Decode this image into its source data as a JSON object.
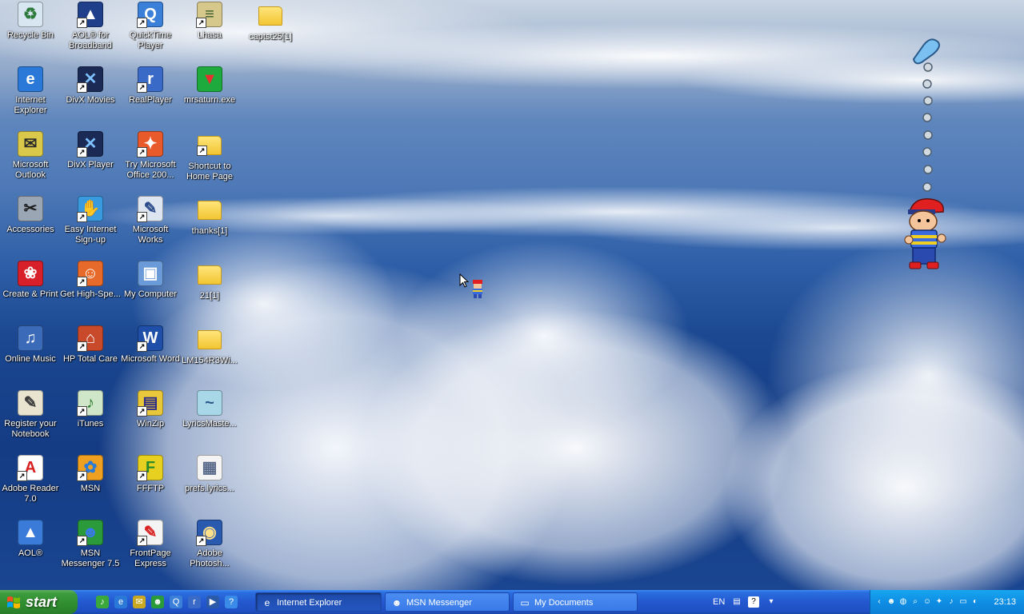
{
  "desktop_icons": [
    {
      "label": "Recycle Bin",
      "icon": "recycle-bin-icon",
      "glyph": "♻",
      "color": "#d8e6f2",
      "fg": "#2e7a3c",
      "shortcut": false
    },
    {
      "label": "AOL® for Broadband",
      "icon": "aol-icon",
      "glyph": "▲",
      "color": "#1f3f8a",
      "fg": "#ffffff",
      "shortcut": true
    },
    {
      "label": "QuickTime Player",
      "icon": "quicktime-icon",
      "glyph": "Q",
      "color": "#3a7fd8",
      "fg": "#ffffff",
      "shortcut": true
    },
    {
      "label": "Lhasa",
      "icon": "lhasa-archive-icon",
      "glyph": "≡",
      "color": "#d6c78a",
      "fg": "#3a5a2a",
      "shortcut": true
    },
    {
      "label": "captst25[1]",
      "icon": "folder-icon",
      "glyph": "",
      "color": "folder",
      "fg": "",
      "shortcut": false
    },
    {
      "label": "Internet Explorer",
      "icon": "internet-explorer-icon",
      "glyph": "e",
      "color": "#2a78d8",
      "fg": "#ffffff",
      "shortcut": false
    },
    {
      "label": "DivX Movies",
      "icon": "divx-movies-icon",
      "glyph": "✕",
      "color": "#1a2a55",
      "fg": "#7fc0ff",
      "shortcut": true
    },
    {
      "label": "RealPlayer",
      "icon": "realplayer-icon",
      "glyph": "r",
      "color": "#3a6ac8",
      "fg": "#ffffff",
      "shortcut": true
    },
    {
      "label": "mrsaturn.exe",
      "icon": "mrsaturn-icon",
      "glyph": "▼",
      "color": "#1eaa3c",
      "fg": "#e83030",
      "shortcut": false
    },
    {
      "label": "Microsoft Outlook",
      "icon": "outlook-icon",
      "glyph": "✉",
      "color": "#d9c84a",
      "fg": "#2a2a2a",
      "shortcut": false
    },
    {
      "label": "DivX Player",
      "icon": "divx-player-icon",
      "glyph": "✕",
      "color": "#1a2a55",
      "fg": "#7fc0ff",
      "shortcut": true
    },
    {
      "label": "Try Microsoft Office 200...",
      "icon": "office-icon",
      "glyph": "✦",
      "color": "#e85a2a",
      "fg": "#ffffff",
      "shortcut": true
    },
    {
      "label": "Shortcut to Home Page",
      "icon": "folder-shortcut-icon",
      "glyph": "",
      "color": "folder",
      "fg": "",
      "shortcut": true
    },
    {
      "label": "Accessories",
      "icon": "accessories-icon",
      "glyph": "✂",
      "color": "#9aa6b4",
      "fg": "#1a1a1a",
      "shortcut": false
    },
    {
      "label": "Easy Internet Sign-up",
      "icon": "easy-internet-icon",
      "glyph": "✋",
      "color": "#3a9ae0",
      "fg": "#ffd94a",
      "shortcut": true
    },
    {
      "label": "Microsoft Works",
      "icon": "works-icon",
      "glyph": "✎",
      "color": "#dde6f0",
      "fg": "#2a4a8a",
      "shortcut": true
    },
    {
      "label": "thanks[1]",
      "icon": "folder-icon",
      "glyph": "",
      "color": "folder",
      "fg": "",
      "shortcut": false
    },
    {
      "label": "Create & Print",
      "icon": "create-print-icon",
      "glyph": "❀",
      "color": "#d8202a",
      "fg": "#ffffff",
      "shortcut": false
    },
    {
      "label": "Get High-Spe...",
      "icon": "get-high-speed-icon",
      "glyph": "☺",
      "color": "#e86a2a",
      "fg": "#ffffff",
      "shortcut": true
    },
    {
      "label": "My Computer",
      "icon": "my-computer-icon",
      "glyph": "▣",
      "color": "#6a9ad8",
      "fg": "#ffffff",
      "shortcut": false
    },
    {
      "label": "21[1]",
      "icon": "folder-icon",
      "glyph": "",
      "color": "folder",
      "fg": "",
      "shortcut": false
    },
    {
      "label": "Online Music",
      "icon": "online-music-icon",
      "glyph": "♫",
      "color": "#3a6ab8",
      "fg": "#ffffff",
      "shortcut": false
    },
    {
      "label": "HP Total Care",
      "icon": "hp-total-care-icon",
      "glyph": "⌂",
      "color": "#c84a2a",
      "fg": "#ffffff",
      "shortcut": true
    },
    {
      "label": "Microsoft Word",
      "icon": "word-icon",
      "glyph": "W",
      "color": "#1f4fa8",
      "fg": "#ffffff",
      "shortcut": true
    },
    {
      "label": "LM154R3Wi...",
      "icon": "folder-icon",
      "glyph": "",
      "color": "folder",
      "fg": "",
      "shortcut": false
    },
    {
      "label": "Register your Notebook",
      "icon": "register-notebook-icon",
      "glyph": "✎",
      "color": "#e8e4d0",
      "fg": "#3a3a3a",
      "shortcut": false
    },
    {
      "label": "iTunes",
      "icon": "itunes-icon",
      "glyph": "♪",
      "color": "#cfe6c8",
      "fg": "#2a7a2a",
      "shortcut": true
    },
    {
      "label": "WinZip",
      "icon": "winzip-icon",
      "glyph": "▤",
      "color": "#e8c83a",
      "fg": "#2a2a8a",
      "shortcut": true
    },
    {
      "label": "LyricsMaste...",
      "icon": "lyricsmaster-icon",
      "glyph": "~",
      "color": "#a8d8e8",
      "fg": "#2a5a8a",
      "shortcut": false
    },
    {
      "label": "Adobe Reader 7.0",
      "icon": "adobe-reader-icon",
      "glyph": "A",
      "color": "#ffffff",
      "fg": "#d82020",
      "shortcut": true
    },
    {
      "label": "MSN",
      "icon": "msn-icon",
      "glyph": "✿",
      "color": "#f0a020",
      "fg": "#2a7ad8",
      "shortcut": true
    },
    {
      "label": "FFFTP",
      "icon": "ffftp-icon",
      "glyph": "F",
      "color": "#e8d020",
      "fg": "#2a8a2a",
      "shortcut": true
    },
    {
      "label": "prefs.lyrics...",
      "icon": "document-icon",
      "glyph": "▦",
      "color": "#f4f4f4",
      "fg": "#5a6a8a",
      "shortcut": false
    },
    {
      "label": "AOL®",
      "icon": "aol-icon",
      "glyph": "▲",
      "color": "#3a7ad8",
      "fg": "#ffffff",
      "shortcut": false
    },
    {
      "label": "MSN Messenger 7.5",
      "icon": "msn-messenger-icon",
      "glyph": "☻",
      "color": "#2a9a3a",
      "fg": "#3a7ae8",
      "shortcut": true
    },
    {
      "label": "FrontPage Express",
      "icon": "frontpage-express-icon",
      "glyph": "✎",
      "color": "#f4f4f4",
      "fg": "#d82020",
      "shortcut": true
    },
    {
      "label": "Adobe Photosh...",
      "icon": "photoshop-icon",
      "glyph": "◉",
      "color": "#2a5ab0",
      "fg": "#ffe08a",
      "shortcut": true
    }
  ],
  "taskbar": {
    "start_label": "start",
    "quick_launch": [
      {
        "icon": "itunes-quicklaunch-icon",
        "glyph": "♪",
        "color": "#3aa83a"
      },
      {
        "icon": "internet-explorer-quicklaunch-icon",
        "glyph": "e",
        "color": "#2a78d8"
      },
      {
        "icon": "outlook-quicklaunch-icon",
        "glyph": "✉",
        "color": "#c8a820"
      },
      {
        "icon": "msn-messenger-quicklaunch-icon",
        "glyph": "☻",
        "color": "#2a9a3a"
      },
      {
        "icon": "quicktime-quicklaunch-icon",
        "glyph": "Q",
        "color": "#3a7fd8"
      },
      {
        "icon": "realplayer-quicklaunch-icon",
        "glyph": "r",
        "color": "#3a6ac8"
      },
      {
        "icon": "media-player-quicklaunch-icon",
        "glyph": "▶",
        "color": "#2a5aa8"
      },
      {
        "icon": "help-quicklaunch-icon",
        "glyph": "?",
        "color": "#3a8ae8"
      }
    ],
    "tasks": [
      {
        "label": "Internet Explorer",
        "icon": "internet-explorer-icon",
        "glyph": "e",
        "active": true
      },
      {
        "label": "MSN Messenger",
        "icon": "msn-messenger-icon",
        "glyph": "☻",
        "active": false
      },
      {
        "label": "My Documents",
        "icon": "folder-icon",
        "glyph": "▭",
        "active": false
      }
    ],
    "language": "EN",
    "tray_icons": [
      {
        "icon": "chevron-left-icon",
        "glyph": "‹"
      },
      {
        "icon": "messenger-tray-icon",
        "glyph": "☻"
      },
      {
        "icon": "network-globe-icon",
        "glyph": "◍"
      },
      {
        "icon": "search-icon",
        "glyph": "⌕"
      },
      {
        "icon": "msn-buddy-icon",
        "glyph": "☺"
      },
      {
        "icon": "satellite-icon",
        "glyph": "✦"
      },
      {
        "icon": "volume-icon",
        "glyph": "♪"
      },
      {
        "icon": "monitor-icon",
        "glyph": "▭"
      },
      {
        "icon": "update-icon",
        "glyph": "◐"
      }
    ],
    "clock": "23:13"
  }
}
